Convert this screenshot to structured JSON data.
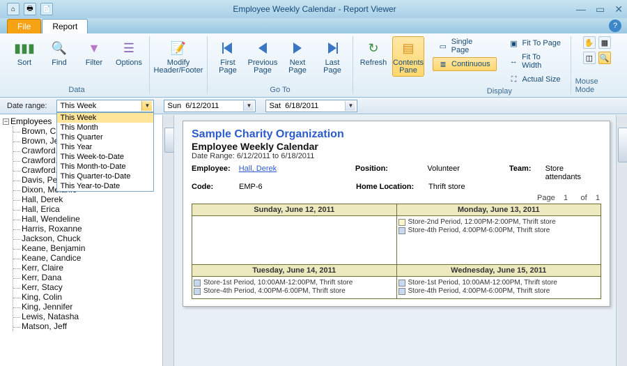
{
  "window": {
    "title": "Employee Weekly Calendar - Report Viewer"
  },
  "tabs": {
    "file": "File",
    "report": "Report"
  },
  "ribbon": {
    "data": {
      "title": "Data",
      "sort": "Sort",
      "find": "Find",
      "filter": "Filter",
      "options": "Options"
    },
    "modify": {
      "label": "Modify Header/Footer"
    },
    "goto": {
      "title": "Go To",
      "first": "First Page",
      "prev": "Previous Page",
      "next": "Next Page",
      "last": "Last Page"
    },
    "refresh": "Refresh",
    "contents": "Contents Pane",
    "display": {
      "title": "Display",
      "single": "Single Page",
      "continuous": "Continuous",
      "fit_page": "Fit To Page",
      "fit_width": "Fit To Width",
      "actual": "Actual Size"
    },
    "mouse": "Mouse Mode"
  },
  "range": {
    "label": "Date range:",
    "selected": "This Week",
    "options": [
      "This Week",
      "This Month",
      "This Quarter",
      "This Year",
      "This Week-to-Date",
      "This Month-to-Date",
      "This Quarter-to-Date",
      "This Year-to-Date"
    ],
    "start_day": "Sun",
    "start_date": "6/12/2011",
    "end_day": "Sat",
    "end_date": "6/18/2011"
  },
  "tree": {
    "root": "Employees",
    "items": [
      "Brown, Chuck",
      "Brown, Jerry",
      "Crawford, Dav",
      "Crawford, Edd",
      "Crawford, Jacq",
      "Davis, Peter",
      "Dixon, Melanie",
      "Hall, Derek",
      "Hall, Erica",
      "Hall, Wendeline",
      "Harris, Roxanne",
      "Jackson, Chuck",
      "Keane, Benjamin",
      "Keane, Candice",
      "Kerr, Claire",
      "Kerr, Dana",
      "Kerr, Stacy",
      "King, Colin",
      "King, Jennifer",
      "Lewis, Natasha",
      "Matson, Jeff"
    ]
  },
  "report": {
    "org": "Sample Charity Organization",
    "title": "Employee Weekly Calendar",
    "range_text": "Date Range: 6/12/2011 to 6/18/2011",
    "labels": {
      "employee": "Employee:",
      "code": "Code:",
      "position": "Position:",
      "home": "Home Location:",
      "team": "Team:"
    },
    "emp": {
      "name": "Hall, Derek",
      "code": "EMP-6",
      "position": "Volunteer",
      "home": "Thrift store",
      "team": "Store attendants"
    },
    "paging": {
      "page_lbl": "Page",
      "page": "1",
      "of_lbl": "of",
      "total": "1"
    },
    "days": [
      "Sunday, June 12, 2011",
      "Monday, June 13, 2011",
      "Tuesday, June 14, 2011",
      "Wednesday, June 15, 2011"
    ],
    "mon_e1": "Store-2nd Period, 12:00PM-2:00PM, Thrift store",
    "mon_e2": "Store-4th Period, 4:00PM-6:00PM, Thrift store",
    "tue_e1": "Store-1st Period, 10:00AM-12:00PM, Thrift store",
    "tue_e2": "Store-4th Period, 4:00PM-6:00PM, Thrift store",
    "wed_e1": "Store-1st Period, 10:00AM-12:00PM, Thrift store",
    "wed_e2": "Store-4th Period, 4:00PM-6:00PM, Thrift store"
  }
}
